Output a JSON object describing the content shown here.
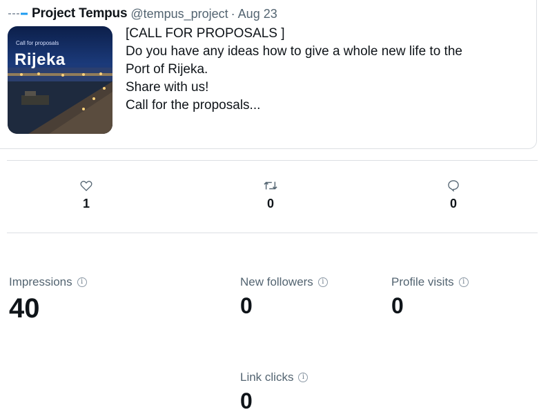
{
  "tweet": {
    "author_name": "Project Tempus",
    "handle": "@tempus_project",
    "separator": "·",
    "date": "Aug 23",
    "image": {
      "small_text": "Call for proposals",
      "big_text": "Rijeka"
    },
    "text_lines": [
      "[CALL FOR PROPOSALS ]",
      "Do you have any ideas how to give a whole new life to the",
      "Port of Rijeka.",
      "Share with us!",
      "Call for the proposals..."
    ]
  },
  "engagement": {
    "likes": {
      "icon": "heart-icon",
      "count": "1"
    },
    "retweets": {
      "icon": "retweet-icon",
      "count": "0"
    },
    "replies": {
      "icon": "reply-icon",
      "count": "0"
    }
  },
  "stats": {
    "impressions": {
      "label": "Impressions",
      "value": "40"
    },
    "new_followers": {
      "label": "New followers",
      "value": "0"
    },
    "profile_visits": {
      "label": "Profile visits",
      "value": "0"
    },
    "link_clicks": {
      "label": "Link clicks",
      "value": "0"
    },
    "info_glyph": "i"
  },
  "colors": {
    "text_primary": "#0f1419",
    "text_secondary": "#536471",
    "border": "#dcdfe3",
    "thread_line": "#1d9bf0"
  }
}
